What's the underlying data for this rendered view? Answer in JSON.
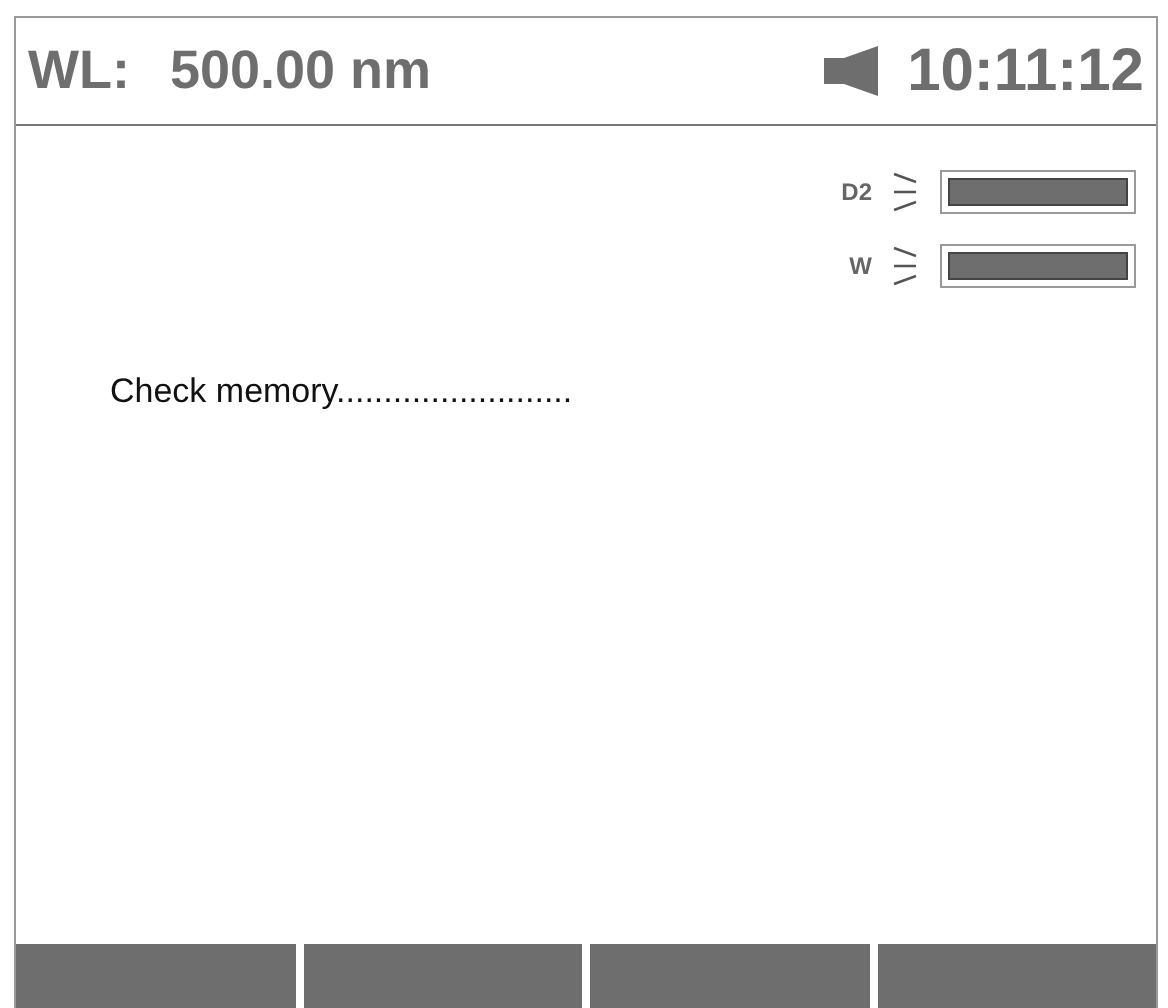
{
  "header": {
    "wavelength_label": "WL:",
    "wavelength": "500.00 nm",
    "time": "10:11:12"
  },
  "lamps": [
    {
      "name": "D2",
      "on": true
    },
    {
      "name": "W",
      "on": true
    }
  ],
  "message": "Check memory.........................",
  "softkeys": [
    {
      "disabled": false
    },
    {
      "disabled": false
    },
    {
      "disabled": false
    },
    {
      "disabled": false
    }
  ]
}
